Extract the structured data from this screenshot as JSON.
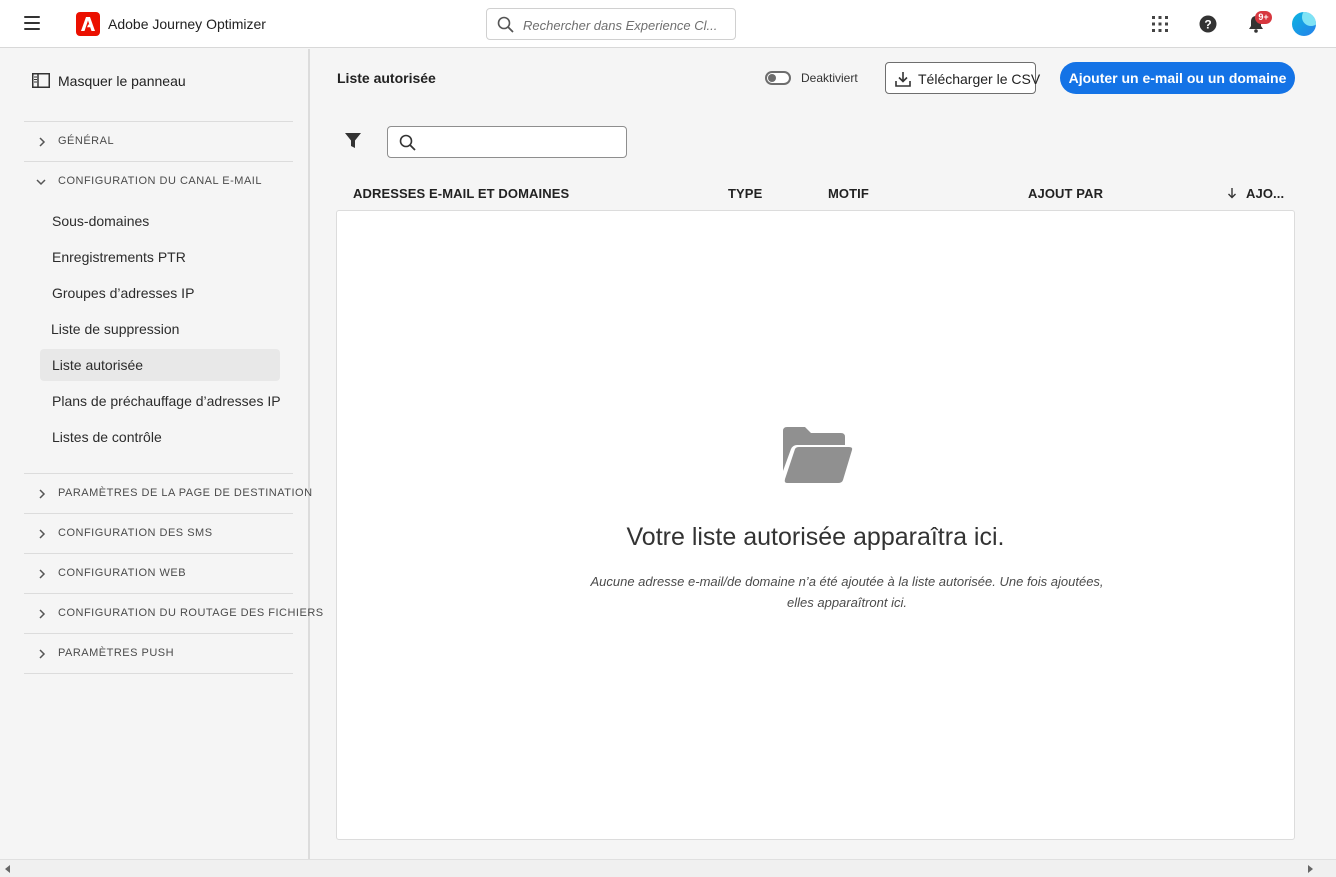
{
  "topbar": {
    "app_title": "Adobe Journey Optimizer",
    "search_placeholder": "Rechercher dans Experience Cl...",
    "notification_count": "9+"
  },
  "sidebar": {
    "hide_panel_label": "Masquer le panneau",
    "sections": [
      {
        "label": "GÉNÉRAL",
        "expanded": false
      },
      {
        "label": "CONFIGURATION DU CANAL E-MAIL",
        "expanded": true
      },
      {
        "label": "PARAMÈTRES DE LA PAGE DE DESTINATION",
        "expanded": false
      },
      {
        "label": "CONFIGURATION DES SMS",
        "expanded": false
      },
      {
        "label": "CONFIGURATION WEB",
        "expanded": false
      },
      {
        "label": "CONFIGURATION DU ROUTAGE DES FICHIERS",
        "expanded": false
      },
      {
        "label": "PARAMÈTRES PUSH",
        "expanded": false
      }
    ],
    "email_items": [
      {
        "label": "Sous-domaines"
      },
      {
        "label": "Enregistrements PTR"
      },
      {
        "label": "Groupes d’adresses IP"
      },
      {
        "label": "Liste de suppression"
      },
      {
        "label": "Liste autorisée",
        "active": true
      },
      {
        "label": "Plans de préchauffage d’adresses IP"
      },
      {
        "label": "Listes de contrôle"
      }
    ]
  },
  "main": {
    "title": "Liste autorisée",
    "toggle_label": "Deaktiviert",
    "toggle_on": false,
    "download_csv_label": "Télécharger le CSV",
    "add_button_label": "Ajouter un e-mail ou un domaine",
    "table_search_value": "",
    "columns": [
      {
        "label": "ADRESSES E-MAIL ET DOMAINES"
      },
      {
        "label": "TYPE"
      },
      {
        "label": "MOTIF"
      },
      {
        "label": "AJOUT PAR"
      },
      {
        "label": "AJO..."
      }
    ],
    "empty_state": {
      "title": "Votre liste autorisée apparaîtra ici.",
      "description": "Aucune adresse e-mail/de domaine n’a été ajoutée à la liste autorisée. Une fois ajoutées, elles apparaîtront ici."
    }
  },
  "colors": {
    "accent": "#1473e6",
    "brand": "#eb1000",
    "badge": "#d7373f"
  }
}
